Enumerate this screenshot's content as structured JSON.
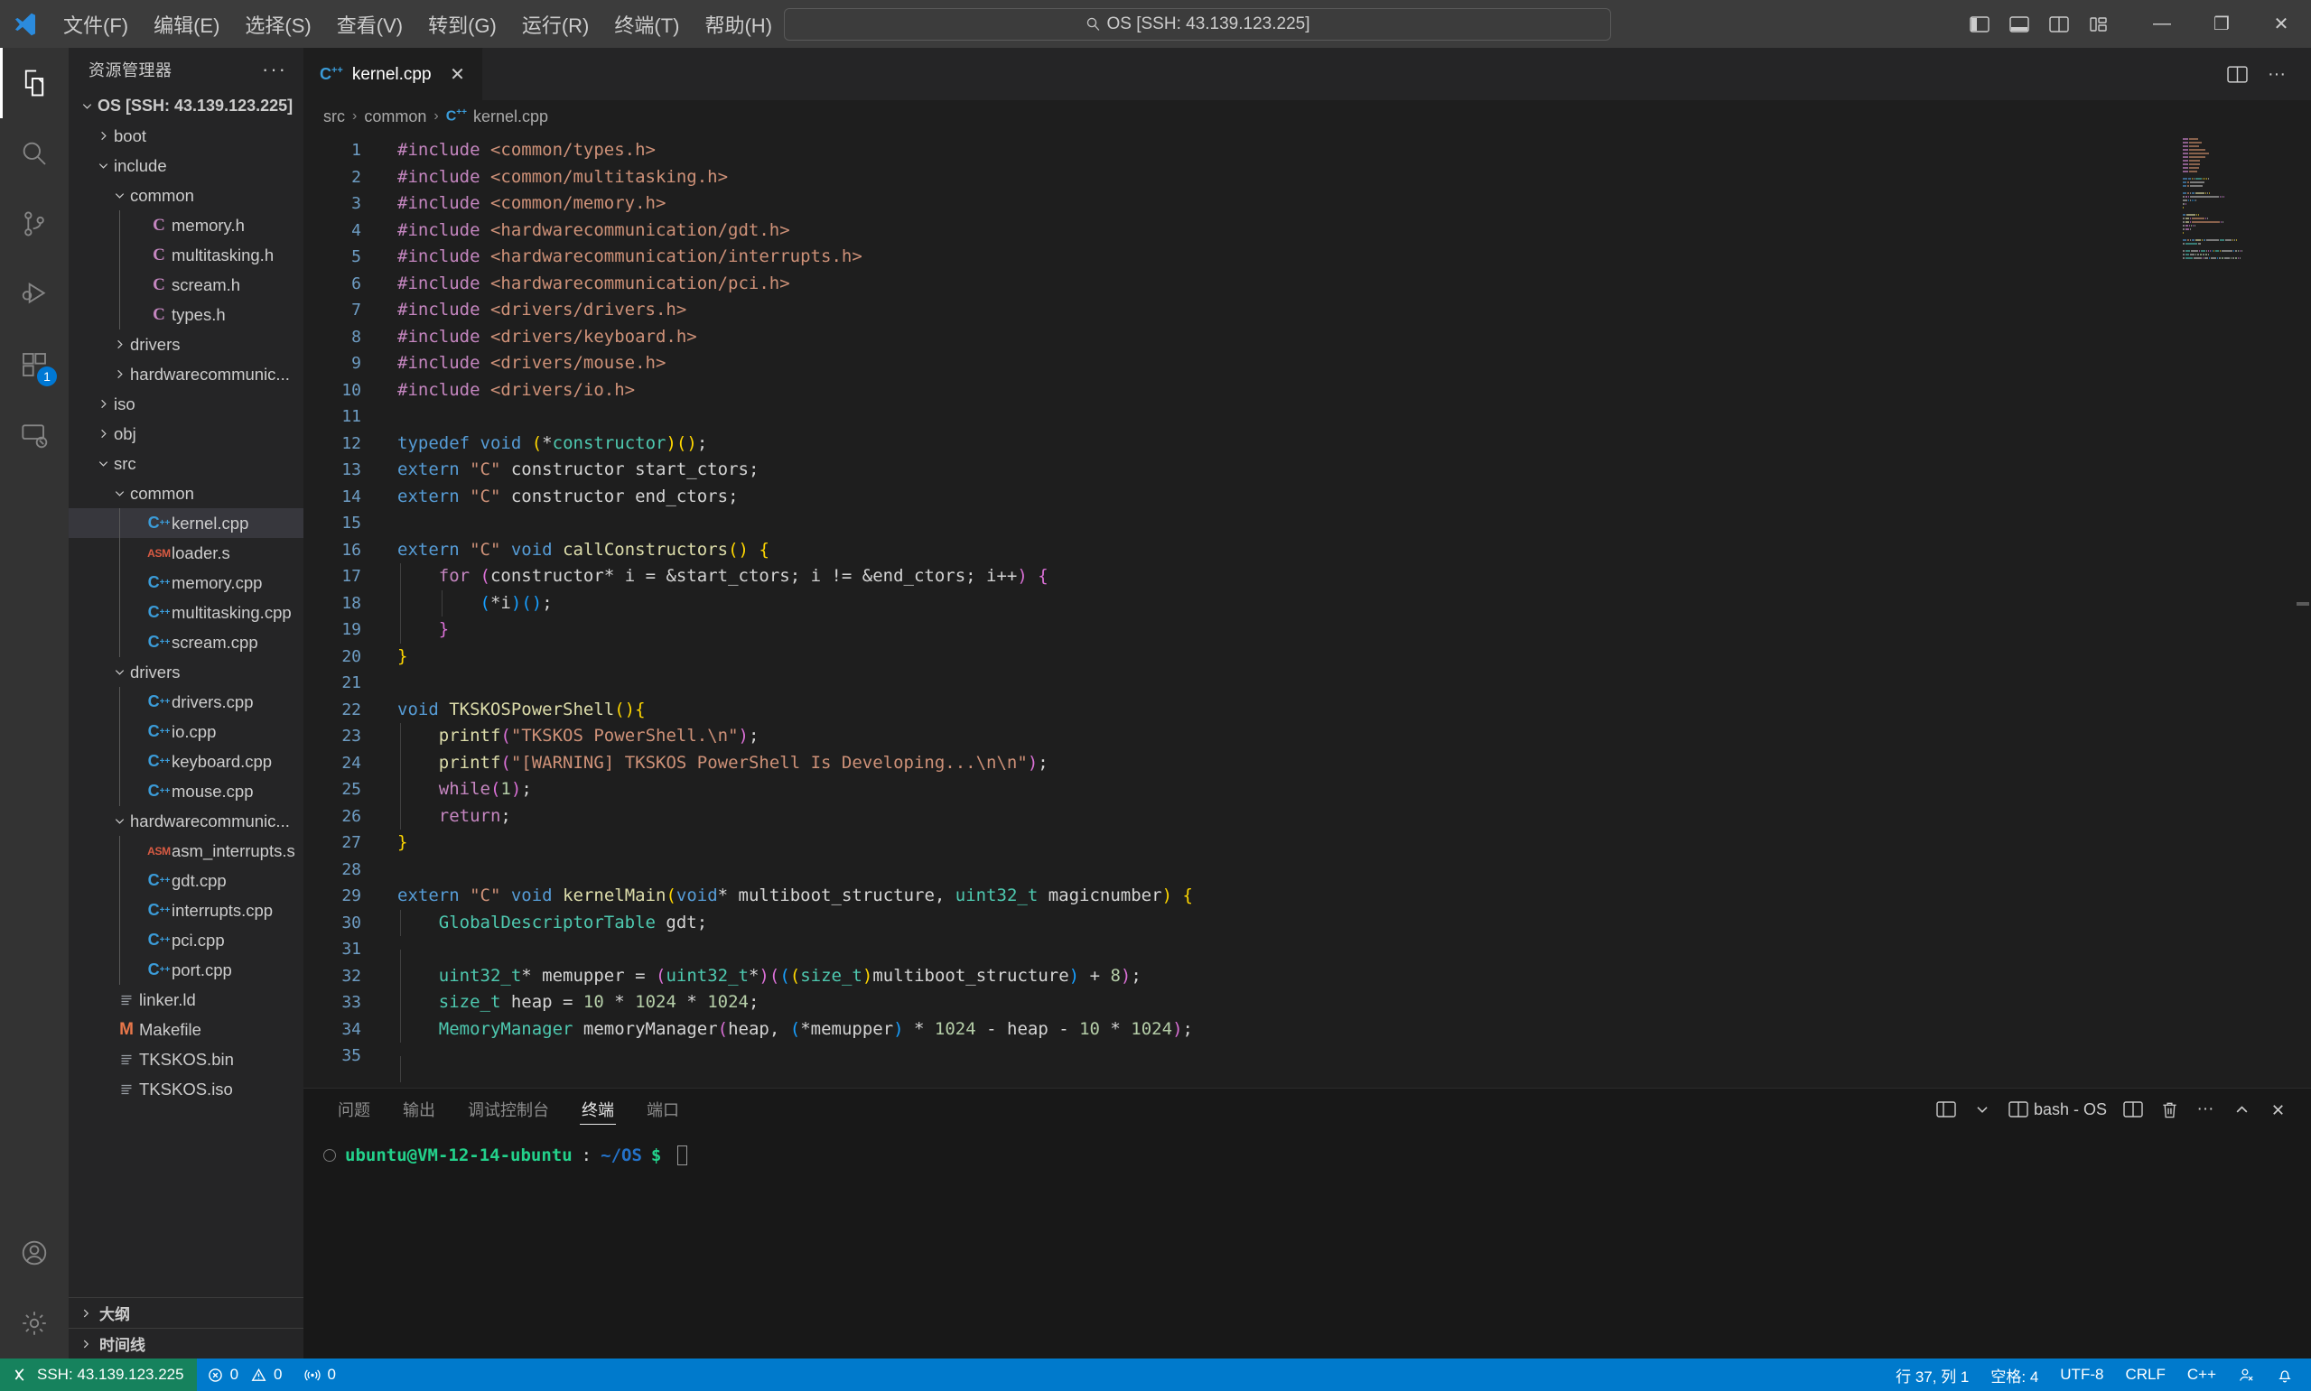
{
  "titlebar": {
    "logo": "vscode-logo",
    "menus": [
      "文件(F)",
      "编辑(E)",
      "选择(S)",
      "查看(V)",
      "转到(G)",
      "运行(R)",
      "终端(T)",
      "帮助(H)"
    ],
    "nav_back": "←",
    "nav_forward": "→",
    "quickinput_text": "OS [SSH: 43.139.123.225]",
    "layout_icons": [
      "toggle-primary-sidebar-icon",
      "toggle-panel-icon",
      "toggle-secondary-sidebar-icon",
      "customize-layout-icon"
    ],
    "window_minimize": "—",
    "window_restore": "❐",
    "window_close": "✕"
  },
  "activitybar": {
    "items": [
      {
        "name": "explorer",
        "icon": "files-icon",
        "active": true,
        "badge": null
      },
      {
        "name": "search",
        "icon": "search-icon",
        "active": false,
        "badge": null
      },
      {
        "name": "source-control",
        "icon": "source-control-icon",
        "active": false,
        "badge": null
      },
      {
        "name": "run-and-debug",
        "icon": "debug-icon",
        "active": false,
        "badge": null
      },
      {
        "name": "extensions",
        "icon": "extensions-icon",
        "active": false,
        "badge": "1"
      },
      {
        "name": "remote-explorer",
        "icon": "remote-explorer-icon",
        "active": false,
        "badge": null
      }
    ],
    "bottom": [
      {
        "name": "accounts",
        "icon": "account-icon"
      },
      {
        "name": "manage",
        "icon": "gear-icon"
      }
    ]
  },
  "sidebar": {
    "title": "资源管理器",
    "more_actions": "···",
    "tree": [
      {
        "depth": 0,
        "label": "OS [SSH: 43.139.123.225]",
        "kind": "root",
        "expanded": true
      },
      {
        "depth": 1,
        "label": "boot",
        "kind": "folder",
        "expanded": false
      },
      {
        "depth": 1,
        "label": "include",
        "kind": "folder",
        "expanded": true
      },
      {
        "depth": 2,
        "label": "common",
        "kind": "folder",
        "expanded": true
      },
      {
        "depth": 3,
        "label": "memory.h",
        "kind": "c"
      },
      {
        "depth": 3,
        "label": "multitasking.h",
        "kind": "c"
      },
      {
        "depth": 3,
        "label": "scream.h",
        "kind": "c"
      },
      {
        "depth": 3,
        "label": "types.h",
        "kind": "c"
      },
      {
        "depth": 2,
        "label": "drivers",
        "kind": "folder",
        "expanded": false
      },
      {
        "depth": 2,
        "label": "hardwarecommunic...",
        "kind": "folder",
        "expanded": false
      },
      {
        "depth": 1,
        "label": "iso",
        "kind": "folder",
        "expanded": false
      },
      {
        "depth": 1,
        "label": "obj",
        "kind": "folder",
        "expanded": false
      },
      {
        "depth": 1,
        "label": "src",
        "kind": "folder",
        "expanded": true
      },
      {
        "depth": 2,
        "label": "common",
        "kind": "folder",
        "expanded": true
      },
      {
        "depth": 3,
        "label": "kernel.cpp",
        "kind": "cpp",
        "selected": true
      },
      {
        "depth": 3,
        "label": "loader.s",
        "kind": "asm"
      },
      {
        "depth": 3,
        "label": "memory.cpp",
        "kind": "cpp"
      },
      {
        "depth": 3,
        "label": "multitasking.cpp",
        "kind": "cpp"
      },
      {
        "depth": 3,
        "label": "scream.cpp",
        "kind": "cpp"
      },
      {
        "depth": 2,
        "label": "drivers",
        "kind": "folder",
        "expanded": true
      },
      {
        "depth": 3,
        "label": "drivers.cpp",
        "kind": "cpp"
      },
      {
        "depth": 3,
        "label": "io.cpp",
        "kind": "cpp"
      },
      {
        "depth": 3,
        "label": "keyboard.cpp",
        "kind": "cpp"
      },
      {
        "depth": 3,
        "label": "mouse.cpp",
        "kind": "cpp"
      },
      {
        "depth": 2,
        "label": "hardwarecommunic...",
        "kind": "folder",
        "expanded": true
      },
      {
        "depth": 3,
        "label": "asm_interrupts.s",
        "kind": "asm"
      },
      {
        "depth": 3,
        "label": "gdt.cpp",
        "kind": "cpp"
      },
      {
        "depth": 3,
        "label": "interrupts.cpp",
        "kind": "cpp"
      },
      {
        "depth": 3,
        "label": "pci.cpp",
        "kind": "cpp"
      },
      {
        "depth": 3,
        "label": "port.cpp",
        "kind": "cpp"
      },
      {
        "depth": 1,
        "label": "linker.ld",
        "kind": "file"
      },
      {
        "depth": 1,
        "label": "Makefile",
        "kind": "makefile"
      },
      {
        "depth": 1,
        "label": "TKSKOS.bin",
        "kind": "file"
      },
      {
        "depth": 1,
        "label": "TKSKOS.iso",
        "kind": "file"
      }
    ],
    "sections": [
      {
        "label": "大纲",
        "expanded": false
      },
      {
        "label": "时间线",
        "expanded": false
      }
    ]
  },
  "editor": {
    "tabs": [
      {
        "label": "kernel.cpp",
        "icon": "cpp-file-icon",
        "active": true,
        "close": "✕"
      }
    ],
    "tab_actions": [
      "split-editor-icon",
      "more-actions-icon"
    ],
    "breadcrumb": [
      "src",
      "common",
      "kernel.cpp"
    ],
    "lines": [
      {
        "n": 1,
        "tokens": [
          [
            "t-pp",
            "#include "
          ],
          [
            "t-ppstr",
            "<common/types.h>"
          ]
        ]
      },
      {
        "n": 2,
        "tokens": [
          [
            "t-pp",
            "#include "
          ],
          [
            "t-ppstr",
            "<common/multitasking.h>"
          ]
        ]
      },
      {
        "n": 3,
        "tokens": [
          [
            "t-pp",
            "#include "
          ],
          [
            "t-ppstr",
            "<common/memory.h>"
          ]
        ]
      },
      {
        "n": 4,
        "tokens": [
          [
            "t-pp",
            "#include "
          ],
          [
            "t-ppstr",
            "<hardwarecommunication/gdt.h>"
          ]
        ]
      },
      {
        "n": 5,
        "tokens": [
          [
            "t-pp",
            "#include "
          ],
          [
            "t-ppstr",
            "<hardwarecommunication/interrupts.h>"
          ]
        ]
      },
      {
        "n": 6,
        "tokens": [
          [
            "t-pp",
            "#include "
          ],
          [
            "t-ppstr",
            "<hardwarecommunication/pci.h>"
          ]
        ]
      },
      {
        "n": 7,
        "tokens": [
          [
            "t-pp",
            "#include "
          ],
          [
            "t-ppstr",
            "<drivers/drivers.h>"
          ]
        ]
      },
      {
        "n": 8,
        "tokens": [
          [
            "t-pp",
            "#include "
          ],
          [
            "t-ppstr",
            "<drivers/keyboard.h>"
          ]
        ]
      },
      {
        "n": 9,
        "tokens": [
          [
            "t-pp",
            "#include "
          ],
          [
            "t-ppstr",
            "<drivers/mouse.h>"
          ]
        ]
      },
      {
        "n": 10,
        "tokens": [
          [
            "t-pp",
            "#include "
          ],
          [
            "t-ppstr",
            "<drivers/io.h>"
          ]
        ]
      },
      {
        "n": 11,
        "tokens": []
      },
      {
        "n": 12,
        "tokens": [
          [
            "t-kw",
            "typedef "
          ],
          [
            "t-kw",
            "void "
          ],
          [
            "t-b1",
            "("
          ],
          [
            "t-plain",
            "*"
          ],
          [
            "t-type",
            "constructor"
          ],
          [
            "t-b1",
            ")"
          ],
          [
            "t-b1",
            "("
          ],
          [
            "t-b1",
            ")"
          ],
          [
            "t-plain",
            ";"
          ]
        ]
      },
      {
        "n": 13,
        "tokens": [
          [
            "t-kw",
            "extern "
          ],
          [
            "t-str",
            "\"C\""
          ],
          [
            "t-plain",
            " constructor start_ctors;"
          ]
        ]
      },
      {
        "n": 14,
        "tokens": [
          [
            "t-kw",
            "extern "
          ],
          [
            "t-str",
            "\"C\""
          ],
          [
            "t-plain",
            " constructor end_ctors;"
          ]
        ]
      },
      {
        "n": 15,
        "tokens": []
      },
      {
        "n": 16,
        "tokens": [
          [
            "t-kw",
            "extern "
          ],
          [
            "t-str",
            "\"C\""
          ],
          [
            "t-plain",
            " "
          ],
          [
            "t-kw",
            "void "
          ],
          [
            "t-fn",
            "callConstructors"
          ],
          [
            "t-b1",
            "()"
          ],
          [
            "t-plain",
            " "
          ],
          [
            "t-b1",
            "{"
          ]
        ]
      },
      {
        "n": 17,
        "tokens": [
          [
            "t-plain",
            "    "
          ],
          [
            "t-kw2",
            "for "
          ],
          [
            "t-b2",
            "("
          ],
          [
            "t-plain",
            "constructor* i = &start_ctors; i != &end_ctors; i++"
          ],
          [
            "t-b2",
            ")"
          ],
          [
            "t-plain",
            " "
          ],
          [
            "t-b2",
            "{"
          ]
        ],
        "guides": [
          1
        ]
      },
      {
        "n": 18,
        "tokens": [
          [
            "t-plain",
            "        "
          ],
          [
            "t-b3",
            "("
          ],
          [
            "t-plain",
            "*i"
          ],
          [
            "t-b3",
            ")"
          ],
          [
            "t-b3",
            "()"
          ],
          [
            "t-plain",
            ";"
          ]
        ],
        "guides": [
          1,
          2
        ]
      },
      {
        "n": 19,
        "tokens": [
          [
            "t-plain",
            "    "
          ],
          [
            "t-b2",
            "}"
          ]
        ],
        "guides": [
          1
        ]
      },
      {
        "n": 20,
        "tokens": [
          [
            "t-b1",
            "}"
          ]
        ]
      },
      {
        "n": 21,
        "tokens": []
      },
      {
        "n": 22,
        "tokens": [
          [
            "t-kw",
            "void "
          ],
          [
            "t-fn",
            "TKSKOSPowerShell"
          ],
          [
            "t-b1",
            "()"
          ],
          [
            "t-b1",
            "{"
          ]
        ]
      },
      {
        "n": 23,
        "tokens": [
          [
            "t-plain",
            "    "
          ],
          [
            "t-fn",
            "printf"
          ],
          [
            "t-b2",
            "("
          ],
          [
            "t-str",
            "\"TKSKOS PowerShell.\\n\""
          ],
          [
            "t-b2",
            ")"
          ],
          [
            "t-plain",
            ";"
          ]
        ],
        "guides": [
          1
        ]
      },
      {
        "n": 24,
        "tokens": [
          [
            "t-plain",
            "    "
          ],
          [
            "t-fn",
            "printf"
          ],
          [
            "t-b2",
            "("
          ],
          [
            "t-str",
            "\"[WARNING] TKSKOS PowerShell Is Developing...\\n\\n\""
          ],
          [
            "t-b2",
            ")"
          ],
          [
            "t-plain",
            ";"
          ]
        ],
        "guides": [
          1
        ]
      },
      {
        "n": 25,
        "tokens": [
          [
            "t-plain",
            "    "
          ],
          [
            "t-kw2",
            "while"
          ],
          [
            "t-b2",
            "("
          ],
          [
            "t-num",
            "1"
          ],
          [
            "t-b2",
            ")"
          ],
          [
            "t-plain",
            ";"
          ]
        ],
        "guides": [
          1
        ]
      },
      {
        "n": 26,
        "tokens": [
          [
            "t-plain",
            "    "
          ],
          [
            "t-kw2",
            "return"
          ],
          [
            "t-plain",
            ";"
          ]
        ],
        "guides": [
          1
        ]
      },
      {
        "n": 27,
        "tokens": [
          [
            "t-b1",
            "}"
          ]
        ]
      },
      {
        "n": 28,
        "tokens": []
      },
      {
        "n": 29,
        "tokens": [
          [
            "t-kw",
            "extern "
          ],
          [
            "t-str",
            "\"C\""
          ],
          [
            "t-plain",
            " "
          ],
          [
            "t-kw",
            "void "
          ],
          [
            "t-fn",
            "kernelMain"
          ],
          [
            "t-b1",
            "("
          ],
          [
            "t-kw",
            "void"
          ],
          [
            "t-plain",
            "* multiboot_structure, "
          ],
          [
            "t-type",
            "uint32_t"
          ],
          [
            "t-plain",
            " magicnumber"
          ],
          [
            "t-b1",
            ")"
          ],
          [
            "t-plain",
            " "
          ],
          [
            "t-b1",
            "{"
          ]
        ]
      },
      {
        "n": 30,
        "tokens": [
          [
            "t-plain",
            "    "
          ],
          [
            "t-type",
            "GlobalDescriptorTable"
          ],
          [
            "t-plain",
            " gdt;"
          ]
        ],
        "guides": [
          1
        ]
      },
      {
        "n": 31,
        "tokens": [],
        "guides": [
          1
        ]
      },
      {
        "n": 32,
        "tokens": [
          [
            "t-plain",
            "    "
          ],
          [
            "t-type",
            "uint32_t"
          ],
          [
            "t-plain",
            "* memupper = "
          ],
          [
            "t-b2",
            "("
          ],
          [
            "t-type",
            "uint32_t"
          ],
          [
            "t-plain",
            "*"
          ],
          [
            "t-b2",
            ")"
          ],
          [
            "t-b2",
            "("
          ],
          [
            "t-b3",
            "("
          ],
          [
            "t-b1",
            "("
          ],
          [
            "t-type",
            "size_t"
          ],
          [
            "t-b1",
            ")"
          ],
          [
            "t-plain",
            "multiboot_structure"
          ],
          [
            "t-b3",
            ")"
          ],
          [
            "t-plain",
            " + "
          ],
          [
            "t-num",
            "8"
          ],
          [
            "t-b2",
            ")"
          ],
          [
            "t-plain",
            ";"
          ]
        ],
        "guides": [
          1
        ]
      },
      {
        "n": 33,
        "tokens": [
          [
            "t-plain",
            "    "
          ],
          [
            "t-type",
            "size_t"
          ],
          [
            "t-plain",
            " heap = "
          ],
          [
            "t-num",
            "10"
          ],
          [
            "t-plain",
            " * "
          ],
          [
            "t-num",
            "1024"
          ],
          [
            "t-plain",
            " * "
          ],
          [
            "t-num",
            "1024"
          ],
          [
            "t-plain",
            ";"
          ]
        ],
        "guides": [
          1
        ]
      },
      {
        "n": 34,
        "tokens": [
          [
            "t-plain",
            "    "
          ],
          [
            "t-type",
            "MemoryManager"
          ],
          [
            "t-plain",
            " memoryManager"
          ],
          [
            "t-b2",
            "("
          ],
          [
            "t-plain",
            "heap, "
          ],
          [
            "t-b3",
            "("
          ],
          [
            "t-plain",
            "*memupper"
          ],
          [
            "t-b3",
            ")"
          ],
          [
            "t-plain",
            " * "
          ],
          [
            "t-num",
            "1024"
          ],
          [
            "t-plain",
            " - heap - "
          ],
          [
            "t-num",
            "10"
          ],
          [
            "t-plain",
            " * "
          ],
          [
            "t-num",
            "1024"
          ],
          [
            "t-b2",
            ")"
          ],
          [
            "t-plain",
            ";"
          ]
        ],
        "guides": [
          1
        ]
      },
      {
        "n": 35,
        "tokens": [],
        "guides": [
          1
        ]
      }
    ]
  },
  "panel": {
    "tabs": [
      {
        "label": "问题",
        "active": false
      },
      {
        "label": "输出",
        "active": false
      },
      {
        "label": "调试控制台",
        "active": false
      },
      {
        "label": "终端",
        "active": true
      },
      {
        "label": "端口",
        "active": false
      }
    ],
    "actions": {
      "launch_profile": "launch-profile-icon",
      "chevron": "chevron-down-icon",
      "terminal_name": "bash - OS",
      "split_terminal": "split-terminal-icon",
      "kill_terminal": "trash-icon",
      "views_and_more": "···",
      "maximize": "⌃",
      "close": "✕"
    },
    "terminal": {
      "user_host": "ubuntu@VM-12-14-ubuntu",
      "colon": ":",
      "path": "~/OS",
      "dollar": "$"
    }
  },
  "statusbar": {
    "remote": {
      "icon": "remote-icon",
      "label": "SSH: 43.139.123.225"
    },
    "problems": {
      "errors_icon": "error-icon",
      "errors": "0",
      "warnings_icon": "warning-icon",
      "warnings": "0"
    },
    "ports": {
      "icon": "radio-tower-icon",
      "count": "0"
    },
    "right": [
      {
        "name": "editor-position",
        "label": "行 37, 列 1"
      },
      {
        "name": "indentation",
        "label": "空格: 4"
      },
      {
        "name": "encoding",
        "label": "UTF-8"
      },
      {
        "name": "eol",
        "label": "CRLF"
      },
      {
        "name": "language-mode",
        "label": "C++"
      },
      {
        "name": "feedback-icon",
        "label": ""
      },
      {
        "name": "notifications-bell-icon",
        "label": ""
      }
    ]
  },
  "colors": {
    "accent": "#007acc",
    "remote_green": "#16825d",
    "titlebar_bg": "#3c3c3c",
    "sidebar_bg": "#252526",
    "editor_bg": "#1e1e1e",
    "panel_bg": "#181818"
  }
}
